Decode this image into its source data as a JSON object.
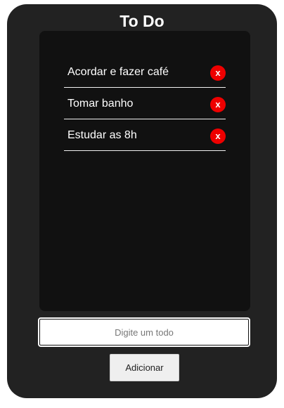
{
  "app": {
    "title": "To Do"
  },
  "todos": [
    {
      "text": "Acordar e fazer café",
      "delete_label": "x"
    },
    {
      "text": "Tomar banho",
      "delete_label": "x"
    },
    {
      "text": "Estudar as 8h",
      "delete_label": "x"
    }
  ],
  "input": {
    "value": "",
    "placeholder": "Digite um todo"
  },
  "add_button": {
    "label": "Adicionar"
  },
  "colors": {
    "app_background": "#222222",
    "panel_background": "#111111",
    "delete_button": "#ee0000",
    "text": "#ffffff"
  }
}
